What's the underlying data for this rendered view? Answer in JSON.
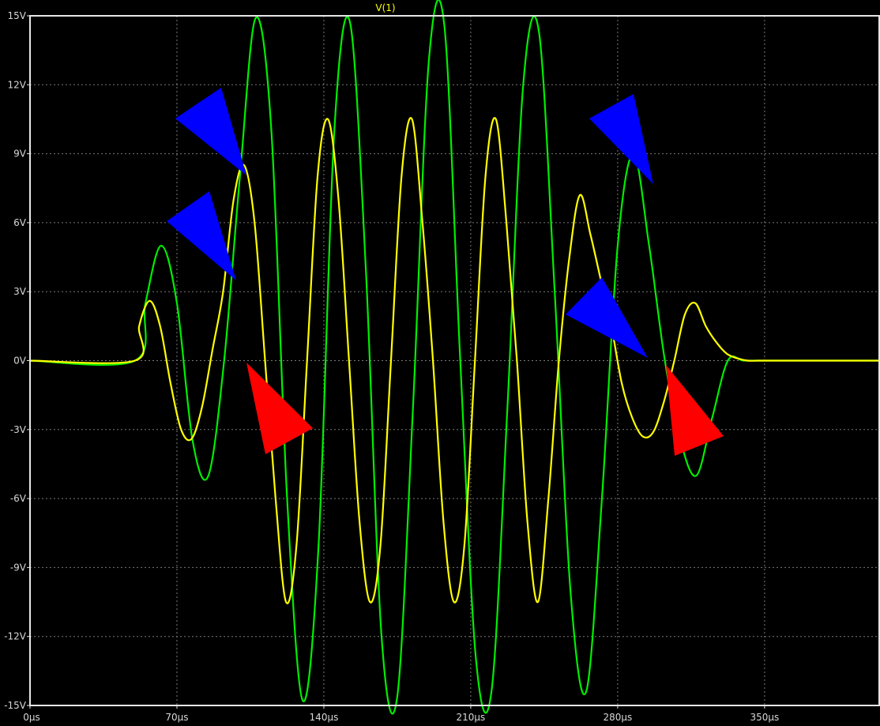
{
  "chart_data": {
    "type": "line",
    "title": "V(1)",
    "xlim": [
      0,
      405
    ],
    "ylim": [
      -15,
      15
    ],
    "x_ticks": [
      0,
      70,
      140,
      210,
      280,
      350
    ],
    "x_tick_labels": [
      "0µs",
      "70µs",
      "140µs",
      "210µs",
      "280µs",
      "350µs"
    ],
    "y_ticks": [
      15,
      12,
      9,
      6,
      3,
      0,
      -3,
      -6,
      -9,
      -12,
      -15
    ],
    "y_tick_labels": [
      "15V",
      "12V",
      "9V",
      "6V",
      "3V",
      "0V",
      "-3V",
      "-6V",
      "-9V",
      "-12V",
      "-15V"
    ],
    "grid": true,
    "background": "#000000",
    "series": [
      {
        "color": "#00ee00",
        "x": [
          0,
          50,
          55,
          62.5,
          70,
          77.5,
          85,
          92.5,
          100,
          107.5,
          115,
          122.5,
          130,
          137.5,
          145,
          152.5,
          160,
          167.5,
          175,
          182.5,
          190,
          197.5,
          205,
          212.5,
          220,
          227.5,
          235,
          242.5,
          250,
          257.5,
          265,
          272.5,
          280,
          287.5,
          295,
          302.5,
          310,
          317.5,
          325,
          332.5,
          340,
          350,
          405
        ],
        "y": [
          0,
          0,
          2.5,
          5,
          2.5,
          -3.5,
          -5,
          0,
          8,
          14.9,
          10,
          -6,
          -14.8,
          -8,
          10,
          14.7,
          4,
          -12,
          -14.6,
          -2,
          13,
          14.5,
          0,
          -13,
          -14.3,
          -2,
          12,
          14.3,
          3,
          -10,
          -14.4,
          -6,
          5,
          9,
          5,
          0,
          -3.5,
          -5,
          -2.5,
          0,
          0,
          0,
          0
        ]
      },
      {
        "color": "#ffff00",
        "x": [
          0,
          50,
          52,
          57,
          62,
          67,
          72,
          77,
          82,
          87,
          92,
          97,
          102,
          107,
          112,
          117,
          122,
          127,
          132,
          137,
          142,
          147,
          152,
          157,
          162,
          167,
          172,
          177,
          182,
          187,
          192,
          197,
          202,
          207,
          212,
          217,
          222,
          227,
          232,
          237,
          242,
          247,
          252,
          257,
          262,
          267,
          272,
          277,
          282,
          287,
          292,
          297,
          302,
          307,
          312,
          317,
          322,
          327,
          332,
          337,
          342,
          347,
          352,
          355,
          360,
          365,
          370,
          380,
          405
        ],
        "y": [
          0,
          0,
          1.5,
          2.6,
          1.5,
          -1,
          -3,
          -3.4,
          -2,
          0.5,
          3,
          7,
          8.5,
          6,
          0,
          -6,
          -10.5,
          -8,
          0,
          8,
          10.5,
          7,
          0,
          -7,
          -10.5,
          -8,
          0,
          8,
          10.5,
          6,
          0,
          -7,
          -10.5,
          -8,
          0,
          8,
          10.5,
          6,
          0,
          -7,
          -10.5,
          -6,
          0,
          4.5,
          7.2,
          5.5,
          3.5,
          1.5,
          -1,
          -2.5,
          -3.3,
          -3.1,
          -1.8,
          0,
          2,
          2.5,
          1.5,
          0.8,
          0.3,
          0.1,
          0,
          0,
          0,
          0,
          0,
          0,
          0,
          0,
          0
        ]
      }
    ]
  },
  "annotations": [
    {
      "shape": "arrow",
      "color": "#0000ff"
    },
    {
      "shape": "arrow",
      "color": "#0000ff"
    },
    {
      "shape": "arrow",
      "color": "#0000ff"
    },
    {
      "shape": "arrow",
      "color": "#0000ff"
    },
    {
      "shape": "arrow",
      "color": "#ff0000"
    },
    {
      "shape": "arrow",
      "color": "#ff0000"
    }
  ]
}
